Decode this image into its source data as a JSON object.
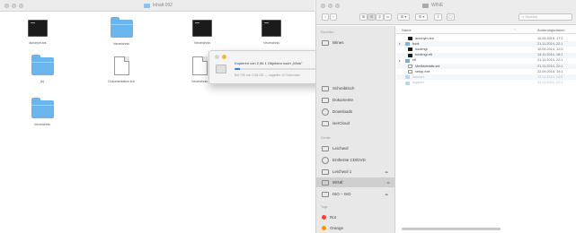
{
  "left_window": {
    "title": "Inhalt 092",
    "icons": [
      {
        "label": "acronym.snt",
        "kind": "terminal"
      },
      {
        "label": "Verzeichnis",
        "kind": "folder"
      },
      {
        "label": "Verzeichnis",
        "kind": "terminal"
      },
      {
        "label": "Verzeichnis",
        "kind": "terminal"
      },
      {
        "label": "(b)",
        "kind": "folder"
      },
      {
        "label": "Dokumentation.snt",
        "kind": "document"
      },
      {
        "label": "Verzeichnis",
        "kind": "document"
      },
      {
        "label": "Verzeichnis",
        "kind": "folder"
      }
    ]
  },
  "copy_dialog": {
    "message": "Kopieren von 2,96 1 Objekten nach „Wink\"",
    "subtext": "Bei 749 von 2,96 GB — ungefähr 10 Sekunden",
    "progress": 0.04
  },
  "right_window": {
    "title": "WINÉ",
    "toolbar": {
      "back": "‹",
      "forward": "›",
      "view_buttons": [
        "⊞",
        "☰",
        "⫼",
        "▭"
      ],
      "arrange": "⊞ ▾",
      "action": "⚙ ▾",
      "share": "⇪",
      "tag": "◯",
      "search_placeholder": "Suchen"
    },
    "sidebar": {
      "favorites_header": "Favoriten",
      "favorites": [
        "Wines",
        "Schreibtisch",
        "Dokumente",
        "Downloads",
        "iserCloud"
      ],
      "devices_header": "Geräte",
      "devices": [
        {
          "label": "Leichwol",
          "eject": ""
        },
        {
          "label": "Entfernte CD/DVD",
          "eject": ""
        },
        {
          "label": "Leichwol 1",
          "eject": "⏏"
        },
        {
          "label": "WINÉ",
          "eject": "⏏",
          "selected": true
        },
        {
          "label": "ISO – ISO",
          "eject": "⏏"
        }
      ],
      "tags_header": "Tags",
      "tags": [
        {
          "label": "Rot",
          "color": "#ff3b30"
        },
        {
          "label": "Orange",
          "color": "#ff9500"
        }
      ]
    },
    "columns": {
      "name": "Name",
      "date": "Änderungsdatum"
    },
    "rows": [
      {
        "name": "acronym.snt",
        "date": "10.09.2015, 17:2",
        "icon": "term",
        "indent": 1,
        "arrow": ""
      },
      {
        "name": "boot",
        "date": "21.11.2014, 22:1",
        "icon": "folder",
        "indent": 0,
        "arrow": "▸"
      },
      {
        "name": "bootmgr",
        "date": "10.09.2014, 12:0",
        "icon": "term",
        "indent": 1,
        "arrow": ""
      },
      {
        "name": "bootmgr.efi",
        "date": "14.11.2014, 16:1",
        "icon": "term",
        "indent": 1,
        "arrow": ""
      },
      {
        "name": "efi",
        "date": "21.11.2014, 22:1",
        "icon": "folder",
        "indent": 0,
        "arrow": "▸"
      },
      {
        "name": "Mediadetails.snt",
        "date": "21.11.2014, 22:1",
        "icon": "doc",
        "indent": 1,
        "arrow": ""
      },
      {
        "name": "setup.exe",
        "date": "22.09.2014, 19:1",
        "icon": "doc",
        "indent": 1,
        "arrow": ""
      },
      {
        "name": "sources",
        "date": "12.11.2014, 13:0",
        "icon": "folder",
        "indent": 0,
        "arrow": "",
        "dim": true
      },
      {
        "name": "support",
        "date": "21.11.2014, 22:1",
        "icon": "folder",
        "indent": 0,
        "arrow": "",
        "dim": true
      }
    ]
  }
}
